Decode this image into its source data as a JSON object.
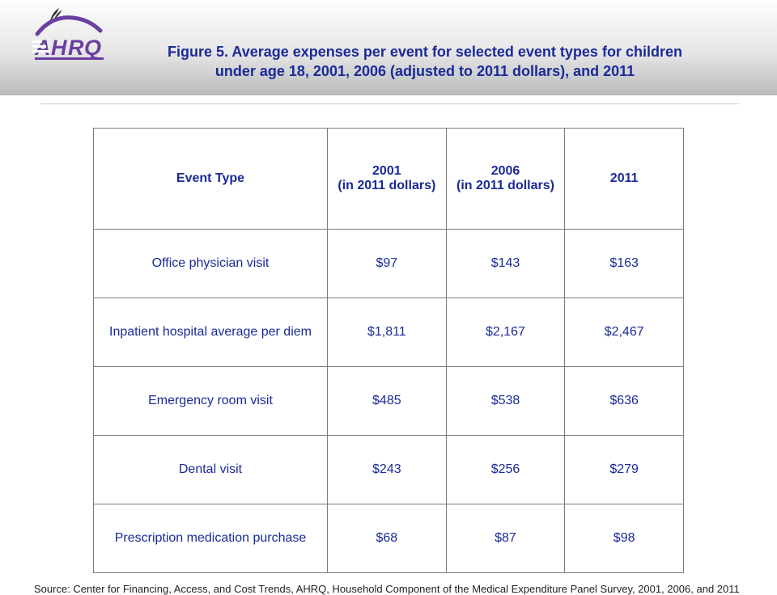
{
  "header": {
    "title": "Figure 5. Average expenses per event for selected event types for children under age 18,  2001, 2006 (adjusted to 2011 dollars), and 2011"
  },
  "table": {
    "headers": [
      "Event Type",
      "2001\n(in 2011 dollars)",
      "2006\n(in 2011 dollars)",
      "2011"
    ],
    "rows": [
      [
        "Office physician visit",
        "$97",
        "$143",
        "$163"
      ],
      [
        "Inpatient hospital average per diem",
        "$1,811",
        "$2,167",
        "$2,467"
      ],
      [
        "Emergency room visit",
        "$485",
        "$538",
        "$636"
      ],
      [
        "Dental visit",
        "$243",
        "$256",
        "$279"
      ],
      [
        "Prescription medication purchase",
        "$68",
        "$87",
        "$98"
      ]
    ]
  },
  "source": "Source: Center for Financing, Access, and Cost Trends, AHRQ, Household Component of the Medical Expenditure Panel Survey,  2001, 2006, and 2011",
  "chart_data": {
    "type": "table",
    "title": "Figure 5. Average expenses per event for selected event types for children under age 18, 2001, 2006 (adjusted to 2011 dollars), and 2011",
    "columns": [
      "Event Type",
      "2001 (in 2011 dollars)",
      "2006 (in 2011 dollars)",
      "2011"
    ],
    "rows": [
      {
        "event_type": "Office physician visit",
        "y2001": 97,
        "y2006": 143,
        "y2011": 163
      },
      {
        "event_type": "Inpatient hospital average per diem",
        "y2001": 1811,
        "y2006": 2167,
        "y2011": 2467
      },
      {
        "event_type": "Emergency room visit",
        "y2001": 485,
        "y2006": 538,
        "y2011": 636
      },
      {
        "event_type": "Dental visit",
        "y2001": 243,
        "y2006": 256,
        "y2011": 279
      },
      {
        "event_type": "Prescription medication purchase",
        "y2001": 68,
        "y2006": 87,
        "y2011": 98
      }
    ],
    "unit": "USD"
  }
}
